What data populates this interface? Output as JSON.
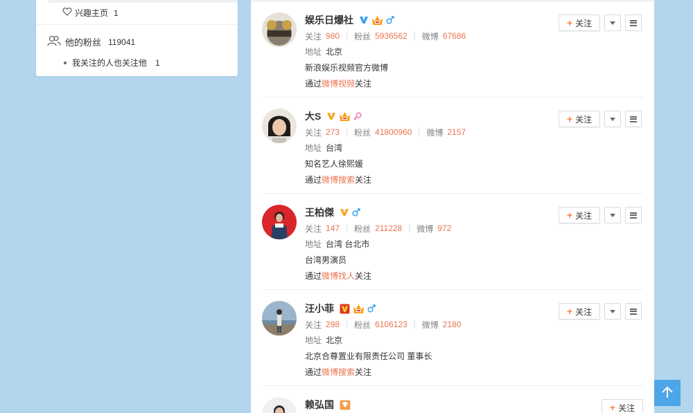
{
  "left_panel": {
    "interest_label": "兴趣主页",
    "interest_count": "1",
    "fans_label": "他的粉丝",
    "fans_count": "119041",
    "mutual_label": "我关注的人也关注他",
    "mutual_count": "1"
  },
  "labels": {
    "following": "关注",
    "fans": "粉丝",
    "weibo": "微博",
    "address": "地址",
    "via": "通过",
    "follow_suffix": "关注",
    "follow_button": "关注"
  },
  "users": [
    {
      "name": "娱乐日爆社",
      "verify": "blue-v",
      "badges": [
        "vip-crown-icon",
        "male-icon"
      ],
      "following": "980",
      "fans": "5936562",
      "weibo": "67686",
      "address": "北京",
      "description": "新浪娱乐视频官方微博",
      "via_source": "微博视频",
      "avatar_color": "#8a7f6e"
    },
    {
      "name": "大S",
      "verify": "yellow-v",
      "badges": [
        "vip-crown-icon",
        "female-icon"
      ],
      "following": "273",
      "fans": "41800960",
      "weibo": "2157",
      "address": "台湾",
      "description": "知名艺人徐熙媛",
      "via_source": "微博搜索",
      "avatar_color": "#c7c2ba"
    },
    {
      "name": "王柏傑",
      "verify": "yellow-v",
      "badges": [
        "male-icon"
      ],
      "following": "147",
      "fans": "211228",
      "weibo": "972",
      "address": "台湾 台北市",
      "description": "台湾男演员",
      "via_source": "微博找人",
      "avatar_color": "#d9262a"
    },
    {
      "name": "汪小菲",
      "verify": "red-v",
      "badges": [
        "vip-crown-icon",
        "male-icon"
      ],
      "following": "298",
      "fans": "6106123",
      "weibo": "2180",
      "address": "北京",
      "description": "北京合尊置业有限责任公司 董事长",
      "via_source": "微博搜索",
      "avatar_color": "#6f8aa3"
    },
    {
      "name": "赖弘国",
      "verify": "",
      "badges": [
        "gem-icon"
      ],
      "avatar_color": "#d0d6dc"
    }
  ],
  "colors": {
    "background": "#b3d6ee",
    "accent": "#eb7350",
    "plus": "#ff8140",
    "back_to_top": "#4da6e8"
  }
}
